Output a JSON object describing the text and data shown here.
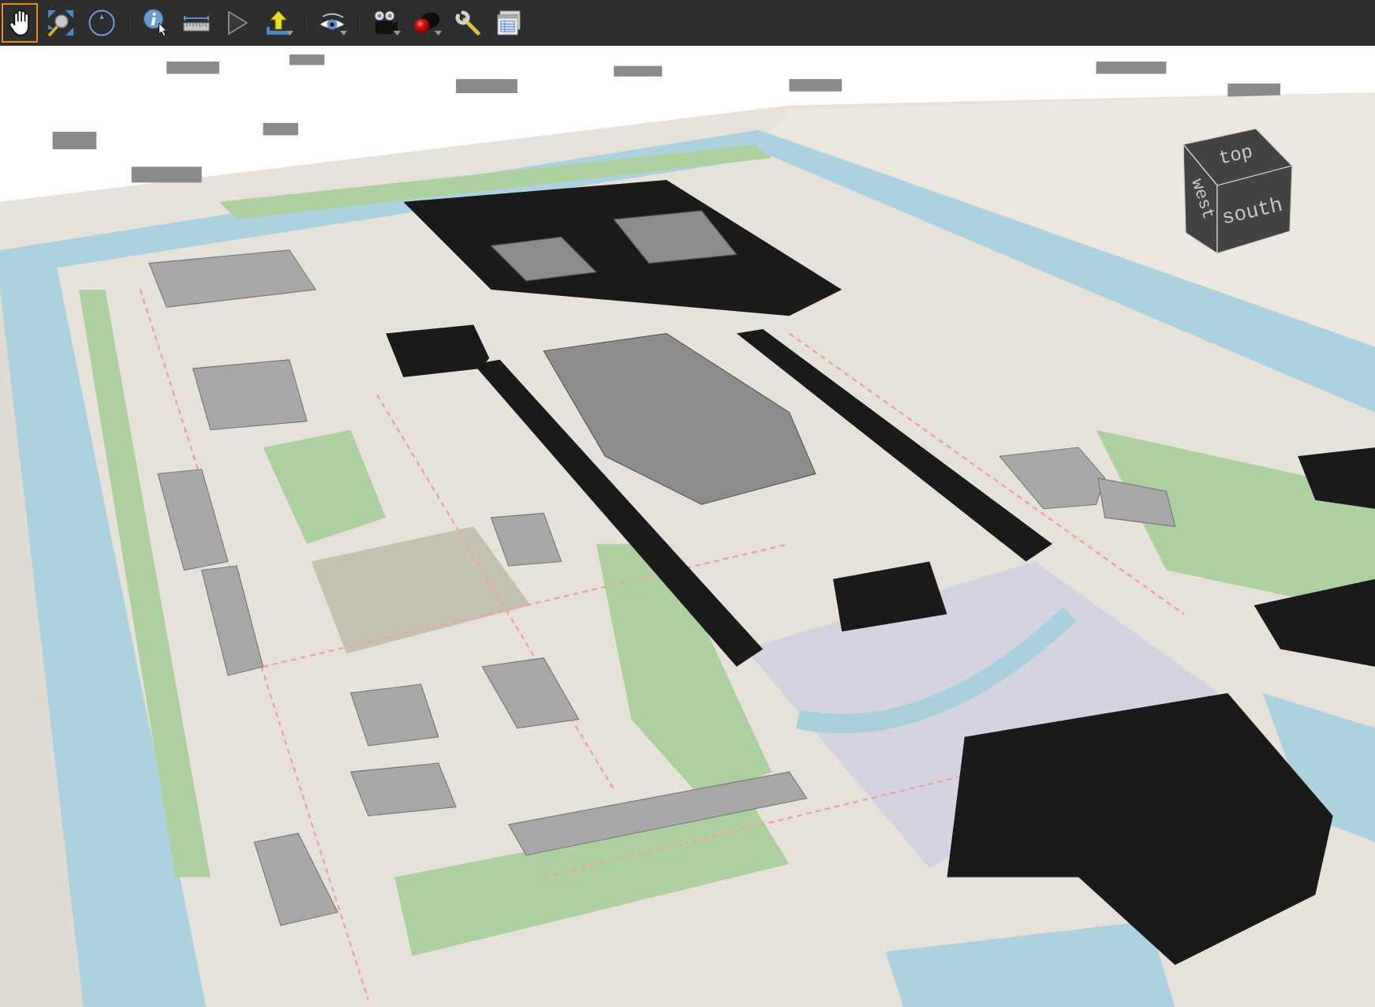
{
  "toolbar": {
    "groups": [
      {
        "tools": [
          {
            "selected": true,
            "dropdown": false
          },
          {
            "selected": false,
            "dropdown": false
          },
          {
            "selected": false,
            "dropdown": false
          }
        ]
      },
      {
        "tools": [
          {
            "selected": false,
            "dropdown": false
          },
          {
            "selected": false,
            "dropdown": false
          },
          {
            "selected": false,
            "dropdown": false
          },
          {
            "selected": false,
            "dropdown": true
          }
        ]
      },
      {
        "tools": [
          {
            "selected": false,
            "dropdown": true
          }
        ]
      },
      {
        "tools": [
          {
            "selected": false,
            "dropdown": true
          },
          {
            "selected": false,
            "dropdown": true
          },
          {
            "selected": false,
            "dropdown": false
          },
          {
            "selected": false,
            "dropdown": false
          }
        ]
      }
    ]
  },
  "view_cube": {
    "faces": [
      {
        "kind": "top",
        "label": "top"
      },
      {
        "kind": "west",
        "label": "west"
      },
      {
        "kind": "south",
        "label": "south"
      }
    ]
  }
}
